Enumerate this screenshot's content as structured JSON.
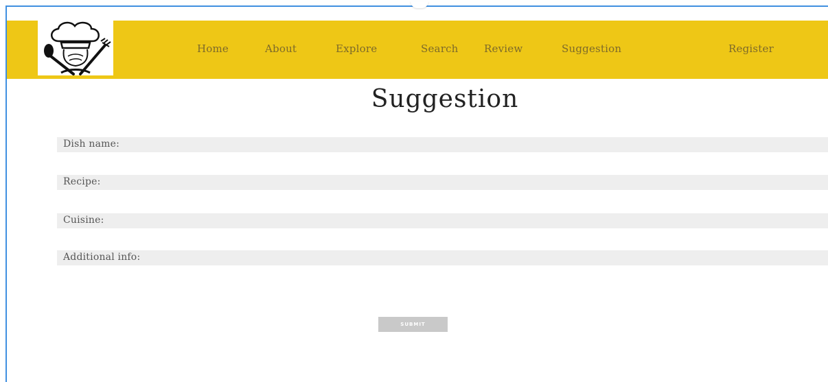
{
  "nav": {
    "logo_alt": "chef hat logo",
    "items": [
      {
        "label": "Home"
      },
      {
        "label": "About"
      },
      {
        "label": "Explore"
      },
      {
        "label": "Search"
      },
      {
        "label": "Review"
      },
      {
        "label": "Suggestion"
      },
      {
        "label": "Register"
      }
    ]
  },
  "page": {
    "title": "Suggestion"
  },
  "form": {
    "fields": [
      {
        "label": "Dish name:",
        "value": ""
      },
      {
        "label": "Recipe:",
        "value": ""
      },
      {
        "label": "Cuisine:",
        "value": ""
      },
      {
        "label": "Additional info:",
        "value": ""
      }
    ],
    "submit_label": "SUBMIT"
  },
  "colors": {
    "navbar": "#eec716",
    "nav_text": "#7d6a2a",
    "field_bg": "#eeeeee",
    "button_bg": "#c9c9c9",
    "frame_border": "#3f8fe0"
  }
}
